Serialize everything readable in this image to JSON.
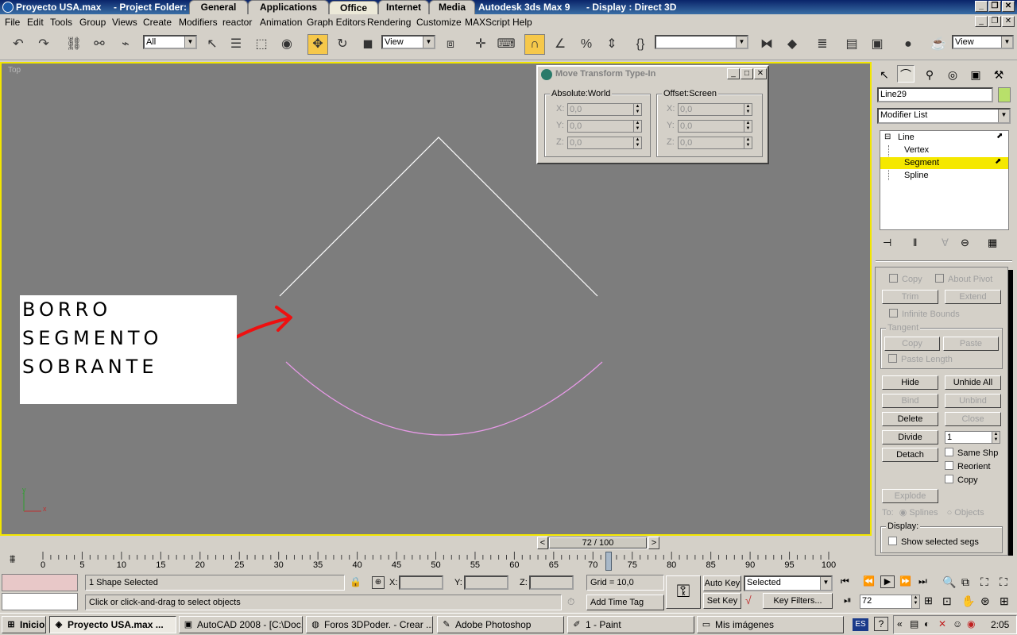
{
  "window": {
    "title": "Proyecto USA.max",
    "project_folder": "- Project Folder:",
    "app_title": "Autodesk 3ds Max 9",
    "display": "- Display : Direct 3D",
    "quick_tabs": [
      "General",
      "Applications",
      "Office",
      "Internet",
      "Media"
    ],
    "active_quick_tab": "Office"
  },
  "menu": [
    "File",
    "Edit",
    "Tools",
    "Group",
    "Views",
    "Create",
    "Modifiers",
    "reactor",
    "Animation",
    "Graph Editors",
    "Rendering",
    "Customize",
    "MAXScript",
    "Help"
  ],
  "toolbar": {
    "selection_filter": "All",
    "ref_coord": "View",
    "named_selection": "",
    "view_dropdown": "View"
  },
  "viewport": {
    "label": "Top",
    "axis_y": "y",
    "axis_x": "x"
  },
  "dialog": {
    "title": "Move Transform Type-In",
    "absolute_group": "Absolute:World",
    "offset_group": "Offset:Screen",
    "absolute": [
      {
        "axis": "X:",
        "value": "0,0"
      },
      {
        "axis": "Y:",
        "value": "0,0"
      },
      {
        "axis": "Z:",
        "value": "0,0"
      }
    ],
    "offset": [
      {
        "axis": "X:",
        "value": "0,0"
      },
      {
        "axis": "Y:",
        "value": "0,0"
      },
      {
        "axis": "Z:",
        "value": "0,0"
      }
    ]
  },
  "annotation": {
    "lines": [
      "BORRO",
      "SEGMENTO",
      "SOBRANTE"
    ],
    "arrow_color": "#ee1010"
  },
  "command_panel": {
    "object_name": "Line29",
    "color_swatch": "#b8e06a",
    "modifier_list": "Modifier List",
    "stack": [
      "Line",
      "Vertex",
      "Segment",
      "Spline"
    ],
    "selected_stack": "Segment",
    "params": {
      "copy": "Copy",
      "about_pivot": "About Pivot",
      "trim": "Trim",
      "extend": "Extend",
      "infinite_bounds": "Infinite Bounds",
      "tangent": "Tangent",
      "tan_copy": "Copy",
      "tan_paste": "Paste",
      "paste_length": "Paste Length",
      "hide": "Hide",
      "unhide_all": "Unhide All",
      "bind": "Bind",
      "unbind": "Unbind",
      "delete": "Delete",
      "close": "Close",
      "divide": "Divide",
      "divide_value": "1",
      "detach": "Detach",
      "same_shp": "Same Shp",
      "reorient": "Reorient",
      "detach_copy": "Copy",
      "explode": "Explode",
      "to": "To:",
      "splines": "Splines",
      "objects": "Objects",
      "display": "Display:",
      "show_selected_segs": "Show selected segs"
    }
  },
  "timeline": {
    "frame": "72 / 100",
    "current": 72,
    "total": 100,
    "ticks": [
      "0",
      "5",
      "10",
      "15",
      "20",
      "25",
      "30",
      "35",
      "40",
      "45",
      "50",
      "55",
      "60",
      "65",
      "70",
      "75",
      "80",
      "85",
      "90",
      "95",
      "100"
    ]
  },
  "status": {
    "selection": "1 Shape Selected",
    "prompt": "Click or click-and-drag to select objects",
    "x_label": "X:",
    "y_label": "Y:",
    "z_label": "Z:",
    "grid": "Grid = 10,0",
    "add_time_tag": "Add Time Tag",
    "auto_key": "Auto Key",
    "set_key": "Set Key",
    "selected_dropdown": "Selected",
    "key_filters": "Key Filters...",
    "frame_field": "72"
  },
  "taskbar": {
    "start": "Inicio",
    "tasks": [
      "Proyecto USA.max",
      "AutoCAD 2008 - [C:\\Doc...",
      "Foros 3DPoder. - Crear ...",
      "Adobe Photoshop",
      "1 - Paint",
      "Mis imágenes"
    ],
    "active_task": "Proyecto USA.max",
    "lang": "ES",
    "clock": "2:05"
  }
}
